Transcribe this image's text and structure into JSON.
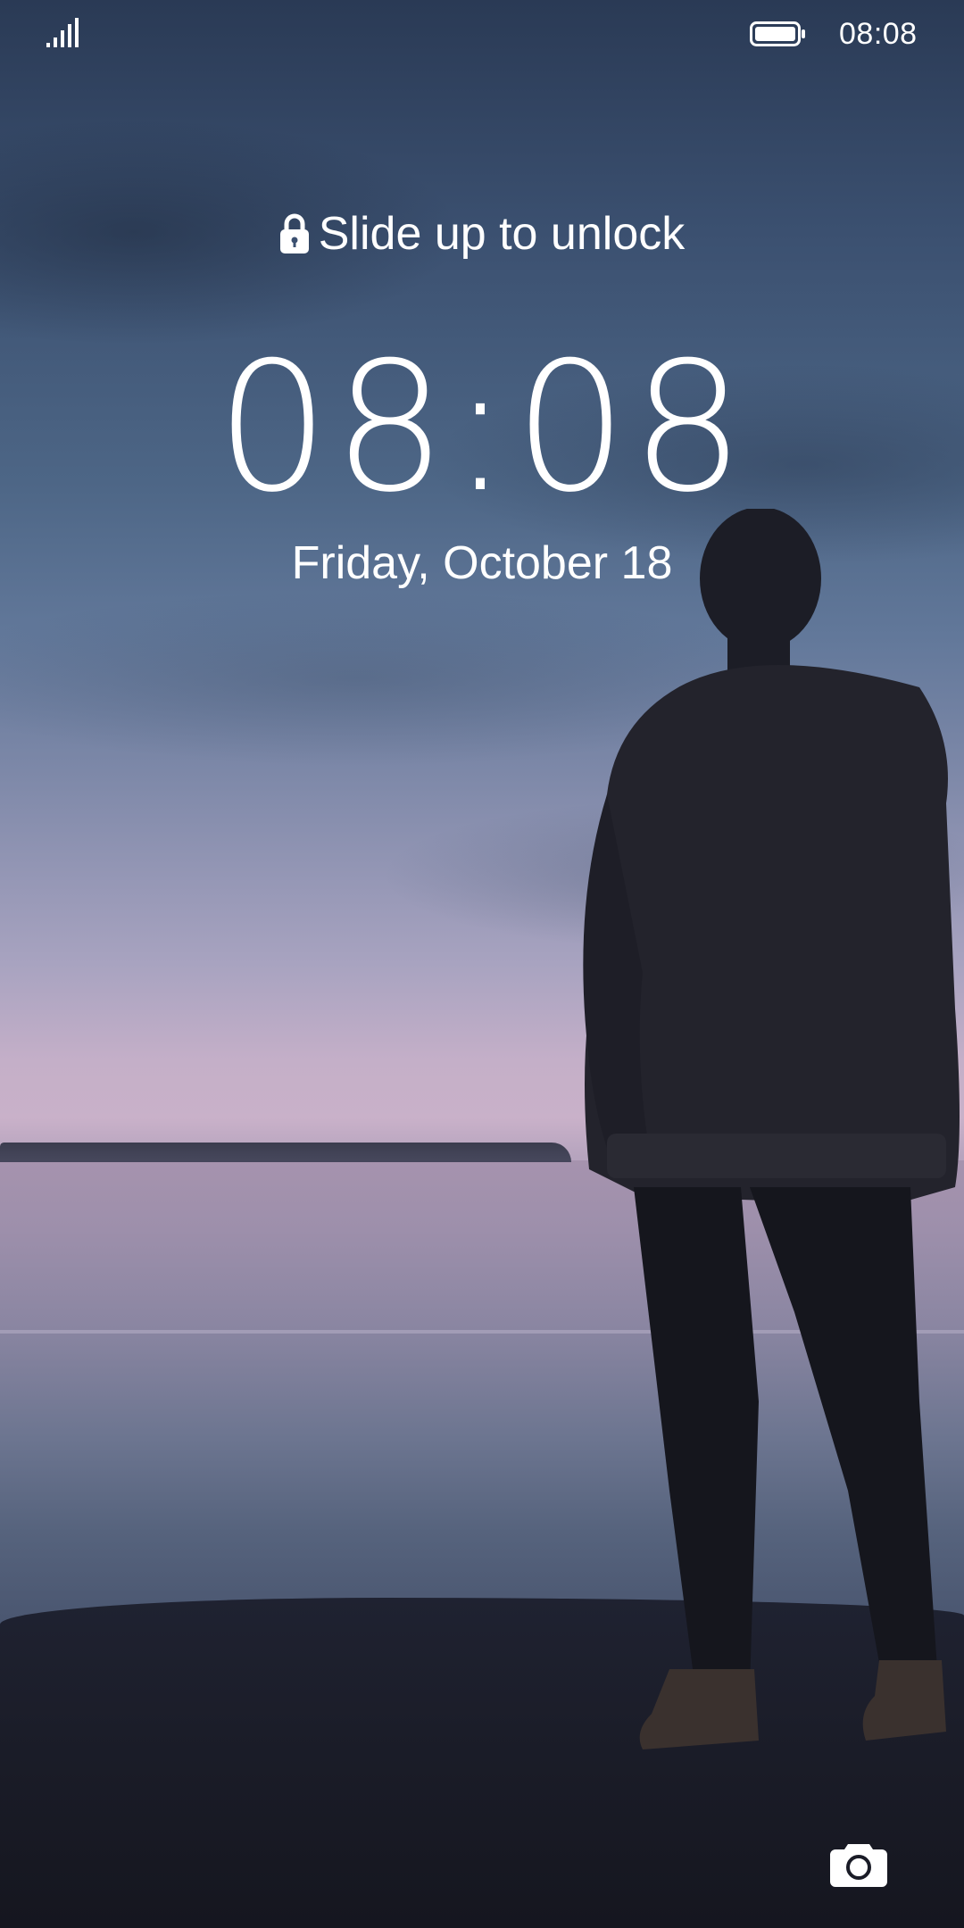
{
  "status_bar": {
    "time": "08:08",
    "signal_icon": "signal-bars-icon",
    "battery_icon": "battery-full-icon"
  },
  "lock_screen": {
    "unlock_hint": "Slide up to unlock",
    "lock_icon": "lock-icon",
    "clock": "08:08",
    "date": "Friday, October 18",
    "camera_icon": "camera-icon"
  },
  "colors": {
    "text": "#ffffff",
    "sky_top": "#2a3a55",
    "sky_horizon": "#c9b1c9",
    "ground": "#15161f"
  }
}
